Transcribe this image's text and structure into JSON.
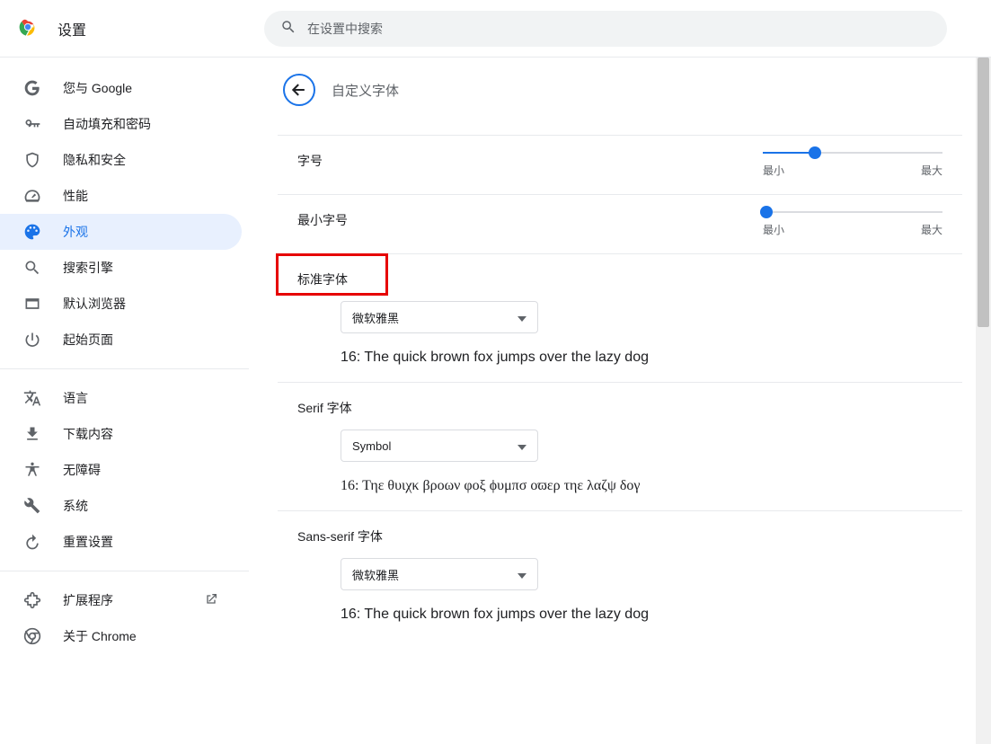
{
  "header": {
    "title": "设置",
    "search_placeholder": "在设置中搜索"
  },
  "sidebar": {
    "items": [
      {
        "label": "您与 Google",
        "icon": "google"
      },
      {
        "label": "自动填充和密码",
        "icon": "key"
      },
      {
        "label": "隐私和安全",
        "icon": "shield"
      },
      {
        "label": "性能",
        "icon": "gauge"
      },
      {
        "label": "外观",
        "icon": "palette"
      },
      {
        "label": "搜索引擎",
        "icon": "search"
      },
      {
        "label": "默认浏览器",
        "icon": "browser"
      },
      {
        "label": "起始页面",
        "icon": "power"
      }
    ],
    "items2": [
      {
        "label": "语言",
        "icon": "translate"
      },
      {
        "label": "下载内容",
        "icon": "download"
      },
      {
        "label": "无障碍",
        "icon": "accessibility"
      },
      {
        "label": "系统",
        "icon": "wrench"
      },
      {
        "label": "重置设置",
        "icon": "reset"
      }
    ],
    "items3": [
      {
        "label": "扩展程序",
        "icon": "extension"
      },
      {
        "label": "关于 Chrome",
        "icon": "chrome"
      }
    ]
  },
  "page": {
    "title": "自定义字体",
    "fontsize": {
      "label": "字号",
      "min": "最小",
      "max": "最大",
      "value_pct": 29
    },
    "minfontsize": {
      "label": "最小字号",
      "min": "最小",
      "max": "最大",
      "value_pct": 2
    },
    "standard": {
      "label": "标准字体",
      "selected": "微软雅黑",
      "preview": "16: The quick brown fox jumps over the lazy dog"
    },
    "serif": {
      "label": "Serif 字体",
      "selected": "Symbol",
      "preview": "16: Τηε θυιχκ βροων φοξ ϕυμπσ οϖερ τηε λαζψ δογ"
    },
    "sans": {
      "label": "Sans-serif 字体",
      "selected": "微软雅黑",
      "preview": "16: The quick brown fox jumps over the lazy dog"
    }
  }
}
